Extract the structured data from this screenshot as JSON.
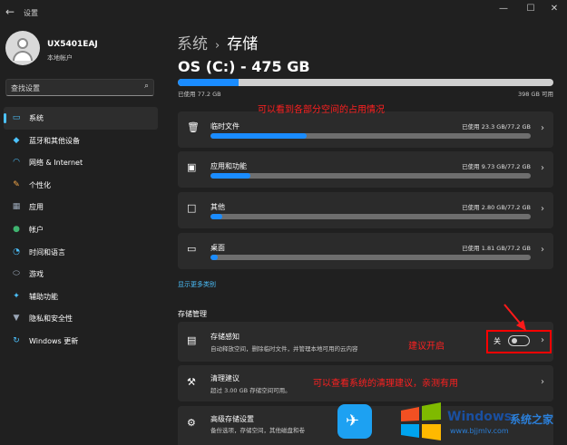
{
  "window": {
    "title": "设置",
    "minimize": "—",
    "maximize": "☐",
    "close": "✕",
    "back": "←"
  },
  "profile": {
    "name": "UX5401EAJ",
    "account_type": "本地帐户"
  },
  "search": {
    "placeholder": "查找设置",
    "icon": "search-icon"
  },
  "sidebar": {
    "items": [
      {
        "label": "系统",
        "icon": "monitor-icon",
        "color": "#4cc2ff",
        "active": true
      },
      {
        "label": "蓝牙和其他设备",
        "icon": "bluetooth-icon",
        "color": "#4cc2ff"
      },
      {
        "label": "网络 & Internet",
        "icon": "wifi-icon",
        "color": "#4cc2ff"
      },
      {
        "label": "个性化",
        "icon": "brush-icon",
        "color": "#f7a94a"
      },
      {
        "label": "应用",
        "icon": "apps-icon",
        "color": "#9aa6b6"
      },
      {
        "label": "帐户",
        "icon": "person-icon",
        "color": "#3fb36f"
      },
      {
        "label": "时间和语言",
        "icon": "globe-clock-icon",
        "color": "#4cc2ff"
      },
      {
        "label": "游戏",
        "icon": "gamepad-icon",
        "color": "#9aa6b6"
      },
      {
        "label": "辅助功能",
        "icon": "accessibility-icon",
        "color": "#4cc2ff"
      },
      {
        "label": "隐私和安全性",
        "icon": "shield-icon",
        "color": "#9aa6b6"
      },
      {
        "label": "Windows 更新",
        "icon": "update-icon",
        "color": "#4cc2ff"
      }
    ]
  },
  "breadcrumb": {
    "parent": "系统",
    "separator": "›",
    "current": "存储"
  },
  "drive": {
    "title": "OS (C:) - 475 GB",
    "used": "已使用 77.2 GB",
    "total": "398 GB 可用",
    "used_fraction": 0.163
  },
  "categories": [
    {
      "name": "临时文件",
      "used": "已使用 23.3 GB/77.2 GB",
      "fraction": 0.3,
      "icon": "trash-icon"
    },
    {
      "name": "应用和功能",
      "used": "已使用 9.73 GB/77.2 GB",
      "fraction": 0.126,
      "icon": "apps-features-icon"
    },
    {
      "name": "其他",
      "used": "已使用 2.80 GB/77.2 GB",
      "fraction": 0.036,
      "icon": "document-icon"
    },
    {
      "name": "桌面",
      "used": "已使用 1.81 GB/77.2 GB",
      "fraction": 0.023,
      "icon": "desktop-icon"
    }
  ],
  "show_more": "显示更多类别",
  "management": {
    "title": "存储管理",
    "storage_sense": {
      "title": "存储感知",
      "subtitle": "自动释放空间，删除临时文件，并管理本地可用的云内容",
      "toggle_label": "关",
      "toggle_on": false
    },
    "cleanup": {
      "title": "清理建议",
      "subtitle": "超过 3.00 GB 存储空间可用。"
    },
    "advanced": {
      "title": "高级存储设置",
      "subtitle": "备份选项，存储空间，其他磁盘和卷"
    }
  },
  "annotations": {
    "usage": "可以看到各部分空间的占用情况",
    "enable": "建议开启",
    "cleanup": "可以查看系统的清理建议，亲测有用",
    "color": "#ff2020"
  },
  "watermark": {
    "brand": "Windows",
    "site_name": "系统之家",
    "url": "www.bjjmlv.com"
  }
}
